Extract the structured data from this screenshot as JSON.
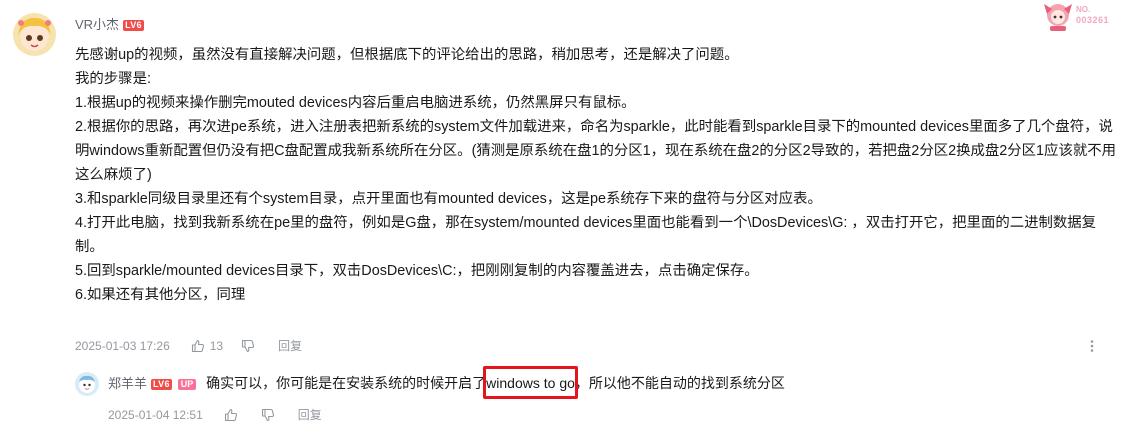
{
  "comment": {
    "username": "VR小杰",
    "level": "LV6",
    "paragraphs": [
      "先感谢up的视频，虽然没有直接解决问题，但根据底下的评论给出的思路，稍加思考，还是解决了问题。",
      "我的步骤是:",
      "1.根据up的视频来操作删完mouted devices内容后重启电脑进系统，仍然黑屏只有鼠标。",
      "2.根据你的思路，再次进pe系统，进入注册表把新系统的system文件加载进来，命名为sparkle，此时能看到sparkle目录下的mounted devices里面多了几个盘符，说明windows重新配置但仍没有把C盘配置成我新系统所在分区。(猜测是原系统在盘1的分区1，现在系统在盘2的分区2导致的，若把盘2分区2换成盘2分区1应该就不用这么麻烦了)",
      "3.和sparkle同级目录里还有个system目录，点开里面也有mounted devices，这是pe系统存下来的盘符与分区对应表。",
      "4.打开此电脑，找到我新系统在pe里的盘符，例如是G盘，那在system/mounted devices里面也能看到一个\\DosDevices\\G: ，双击打开它，把里面的二进制数据复制。",
      "5.回到sparkle/mounted devices目录下，双击DosDevices\\C:，把刚刚复制的内容覆盖进去，点击确定保存。",
      "6.如果还有其他分区，同理"
    ],
    "time": "2025-01-03 17:26",
    "likes": "13",
    "reply_label": "回复"
  },
  "reply": {
    "username": "郑羊羊",
    "level": "LV6",
    "up_badge": "UP",
    "text_before": "确实可以，你可能是在安装系统的时候开启了",
    "text_highlight": "windows to go",
    "text_after": "，所以他不能自动的找到系统分区",
    "time": "2025-01-04 12:51",
    "reply_label": "回复"
  },
  "fan_badge": {
    "label": "NO.",
    "number": "003261"
  },
  "colors": {
    "level_badge": "#f04c49",
    "up_badge": "#fb7299",
    "highlight_box": "#e4131c",
    "meta_text": "#9499a0"
  }
}
